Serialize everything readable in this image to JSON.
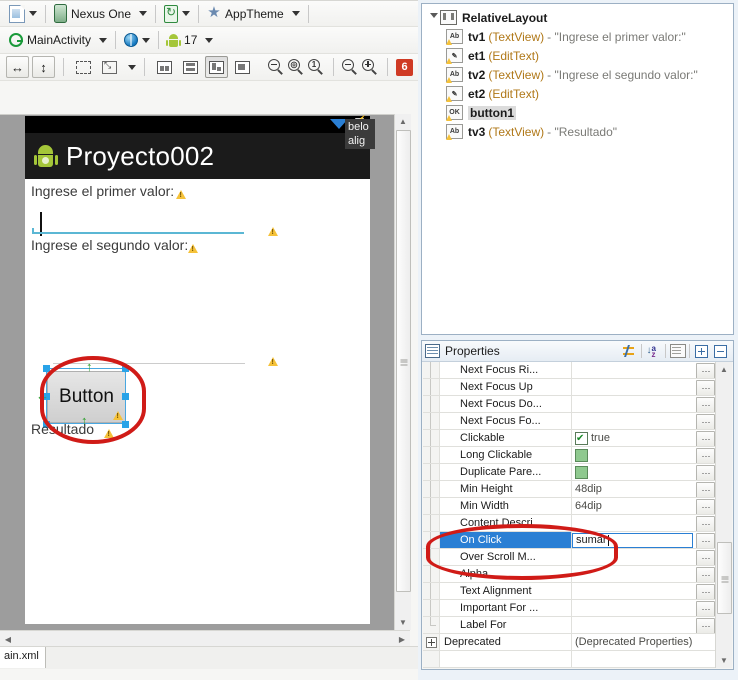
{
  "toolbar_row1": {
    "config_dropdown": {
      "icon": "layout-config-icon",
      "label": ""
    },
    "device": {
      "icon": "device-icon",
      "label": "Nexus One"
    },
    "orientation": {
      "icon": "rotate-icon",
      "label": ""
    },
    "theme": {
      "icon": "theme-star-icon",
      "label": "AppTheme"
    }
  },
  "toolbar_row2": {
    "activity": {
      "icon": "activity-icon",
      "label": "MainActivity"
    },
    "locale": {
      "icon": "globe-icon",
      "label": ""
    },
    "api_level": {
      "icon": "android-icon",
      "label": "17"
    }
  },
  "toolbar_row3": {
    "buttons": [
      {
        "name": "match-width-button",
        "glyph": "↔"
      },
      {
        "name": "match-height-button",
        "glyph": "↕"
      },
      {
        "name": "show-included-button",
        "glyph": ""
      },
      {
        "name": "outline-mode-button",
        "glyph": ""
      },
      {
        "name": "layout-structure-1-button",
        "glyph": ""
      },
      {
        "name": "layout-structure-2-button",
        "glyph": ""
      },
      {
        "name": "layout-structure-3-button",
        "glyph": ""
      },
      {
        "name": "layout-structure-4-button",
        "glyph": ""
      },
      {
        "name": "zoom-out-fit-button",
        "glyph": ""
      },
      {
        "name": "zoom-fit-button",
        "glyph": ""
      },
      {
        "name": "zoom-100-button",
        "glyph": "1"
      },
      {
        "name": "zoom-minus-button",
        "glyph": "−"
      },
      {
        "name": "zoom-plus-button",
        "glyph": "+"
      }
    ],
    "warning_badge": "6"
  },
  "preview": {
    "app_title": "Proyecto002",
    "label1": "Ingrese el primer valor:",
    "label2": "Ingrese el segundo valor:",
    "button_text": "Button",
    "result_text": "Resultado",
    "tooltip_line1": "belo",
    "tooltip_line2": "alig",
    "selected_widget": "button1"
  },
  "outline": {
    "root": {
      "name": "RelativeLayout",
      "icon": "relativelayout-icon"
    },
    "children": [
      {
        "icon": "textview-icon",
        "name": "tv1",
        "type": "(TextView)",
        "value": "- \"Ingrese el primer valor:\"",
        "selected": false
      },
      {
        "icon": "edittext-icon",
        "name": "et1",
        "type": "(EditText)",
        "value": "",
        "selected": false
      },
      {
        "icon": "textview-icon",
        "name": "tv2",
        "type": "(TextView)",
        "value": "- \"Ingrese el segundo valor:\"",
        "selected": false
      },
      {
        "icon": "edittext-icon",
        "name": "et2",
        "type": "(EditText)",
        "value": "",
        "selected": false
      },
      {
        "icon": "button-icon",
        "name": "button1",
        "type": "",
        "value": "",
        "selected": true
      },
      {
        "icon": "textview-icon",
        "name": "tv3",
        "type": "(TextView)",
        "value": "- \"Resultado\"",
        "selected": false
      }
    ]
  },
  "properties": {
    "title": "Properties",
    "toolbar": [
      {
        "name": "show-advanced-button",
        "label": ""
      },
      {
        "name": "sort-alphabetically-button",
        "label": ""
      },
      {
        "name": "filter-button",
        "label": ""
      },
      {
        "name": "expand-all-button",
        "label": ""
      },
      {
        "name": "collapse-all-button",
        "label": ""
      }
    ],
    "rows": [
      {
        "name": "Next Focus Ri...",
        "value": "",
        "kind": "text",
        "selected": false
      },
      {
        "name": "Next Focus Up",
        "value": "",
        "kind": "text",
        "selected": false
      },
      {
        "name": "Next Focus Do...",
        "value": "",
        "kind": "text",
        "selected": false
      },
      {
        "name": "Next Focus Fo...",
        "value": "",
        "kind": "text",
        "selected": false
      },
      {
        "name": "Clickable",
        "value": "true",
        "kind": "checked",
        "selected": false
      },
      {
        "name": "Long Clickable",
        "value": "",
        "kind": "checkbox",
        "selected": false
      },
      {
        "name": "Duplicate Pare...",
        "value": "",
        "kind": "checkbox",
        "selected": false
      },
      {
        "name": "Min Height",
        "value": "48dip",
        "kind": "text",
        "selected": false
      },
      {
        "name": "Min Width",
        "value": "64dip",
        "kind": "text",
        "selected": false
      },
      {
        "name": "Content Descri...",
        "value": "",
        "kind": "text",
        "selected": false
      },
      {
        "name": "On Click",
        "value": "sumar",
        "kind": "editing",
        "selected": true
      },
      {
        "name": "Over Scroll M...",
        "value": "",
        "kind": "text",
        "selected": false
      },
      {
        "name": "Alpha",
        "value": "",
        "kind": "text",
        "selected": false
      },
      {
        "name": "Text Alignment",
        "value": "",
        "kind": "text",
        "selected": false
      },
      {
        "name": "Important For ...",
        "value": "",
        "kind": "text",
        "selected": false
      },
      {
        "name": "Label For",
        "value": "",
        "kind": "text",
        "selected": false
      }
    ],
    "group_row": {
      "name": "Deprecated",
      "value": "(Deprecated Properties)"
    }
  },
  "bottom_tab": {
    "label": "ain.xml"
  },
  "colors": {
    "selection_blue": "#2a7fd4",
    "annotation_red": "#d01b17",
    "warning_yellow": "#f5c23a",
    "android_green": "#a4c639",
    "badge_red": "#cf3a24",
    "type_orange": "#b07818",
    "handle_blue": "#29a3e8"
  }
}
